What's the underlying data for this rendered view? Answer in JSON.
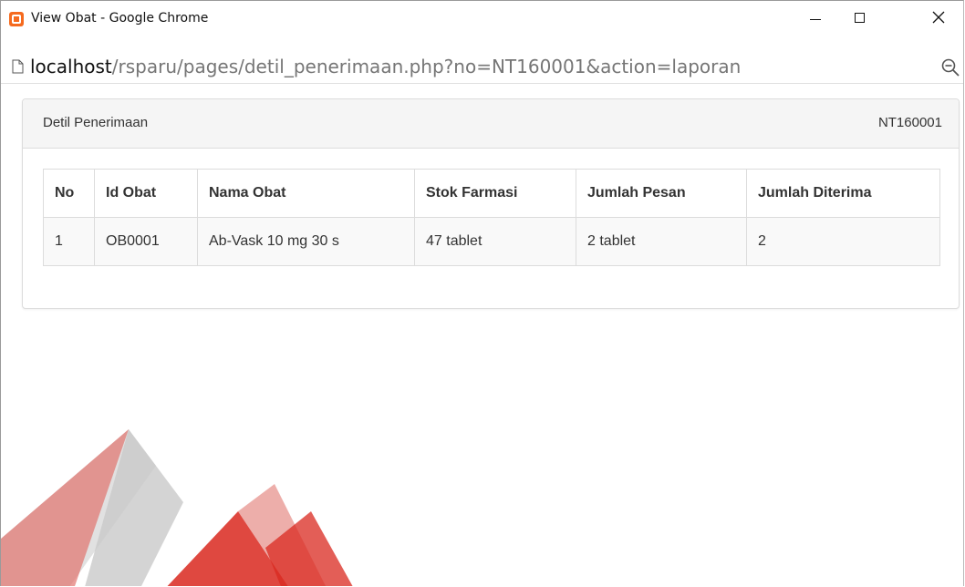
{
  "window": {
    "title": "View Obat - Google Chrome"
  },
  "address": {
    "host": "localhost",
    "path": "/rsparu/pages/detil_penerimaan.php?no=NT160001&action=laporan"
  },
  "panel": {
    "title": "Detil Penerimaan",
    "number": "NT160001"
  },
  "table": {
    "headers": [
      "No",
      "Id Obat",
      "Nama Obat",
      "Stok Farmasi",
      "Jumlah Pesan",
      "Jumlah Diterima"
    ],
    "rows": [
      [
        "1",
        "OB0001",
        "Ab-Vask 10 mg 30 s",
        "47 tablet",
        "2 tablet",
        "2"
      ]
    ]
  },
  "colors": {
    "app_icon": "#f56a1e",
    "watermark_red": "#d9281f",
    "watermark_grey": "#bdbdbd"
  }
}
